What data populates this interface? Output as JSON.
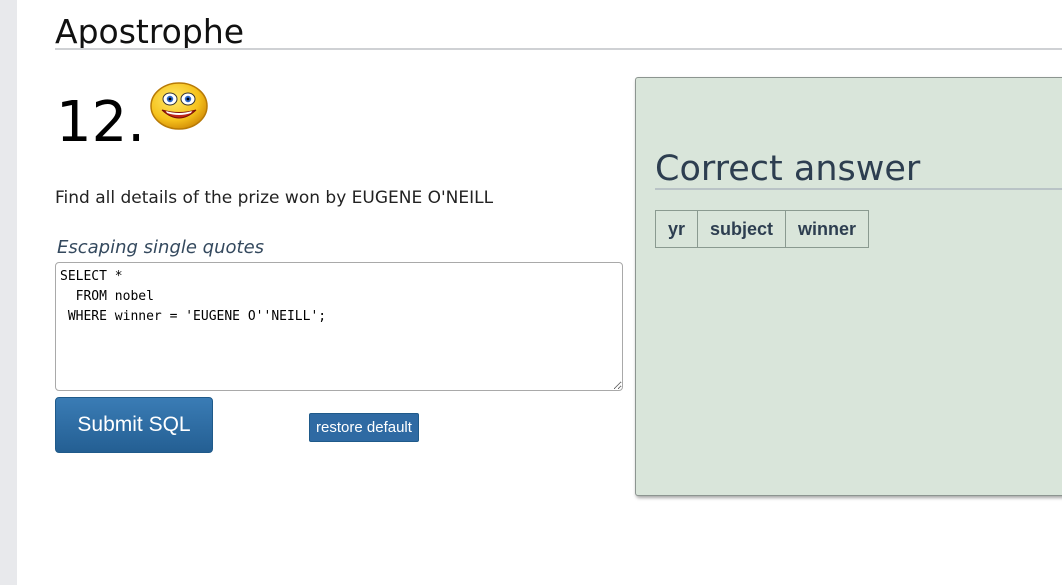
{
  "section": {
    "title": "Apostrophe"
  },
  "question": {
    "number": "12.",
    "prompt": "Find all details of the prize won by EUGENE O'NEILL",
    "hint": "Escaping single quotes",
    "sql": "SELECT *\n  FROM nobel\n WHERE winner = 'EUGENE O''NEILL';"
  },
  "actions": {
    "submit_label": "Submit SQL",
    "restore_label": "restore default"
  },
  "answer": {
    "title": "Correct answer",
    "columns": [
      "yr",
      "subject",
      "winner"
    ]
  },
  "icons": {
    "emoji": "smiley-icon"
  },
  "colors": {
    "panel_bg": "#d9e5da",
    "button_blue": "#2f6aa3",
    "heading": "#2d3e50"
  }
}
